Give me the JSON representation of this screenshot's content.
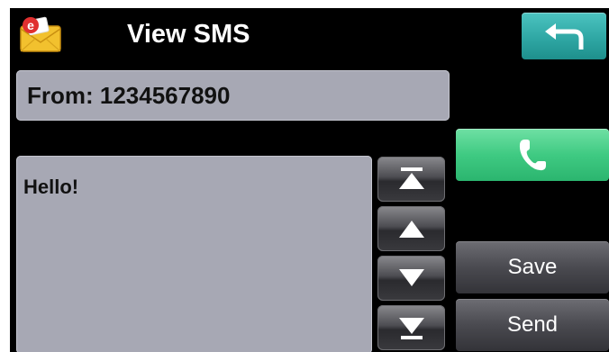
{
  "header": {
    "title": "View SMS",
    "app_icon": "envelope-email-icon",
    "back_icon": "back-arrow-icon"
  },
  "from": {
    "label": "From: 1234567890"
  },
  "message": {
    "body": "Hello!"
  },
  "scroll_controls": [
    {
      "name": "scroll-to-top-button",
      "icon": "scroll-top-icon"
    },
    {
      "name": "scroll-up-button",
      "icon": "arrow-up-icon"
    },
    {
      "name": "scroll-down-button",
      "icon": "arrow-down-icon"
    },
    {
      "name": "scroll-to-bottom-button",
      "icon": "scroll-bottom-icon"
    }
  ],
  "actions": {
    "call_icon": "phone-icon",
    "save_label": "Save",
    "send_label": "Send"
  },
  "colors": {
    "background": "#000000",
    "field": "#a7a8b4",
    "back_button": "#2fa7a4",
    "call_button": "#3fca82",
    "action_button": "#4a4a50"
  }
}
